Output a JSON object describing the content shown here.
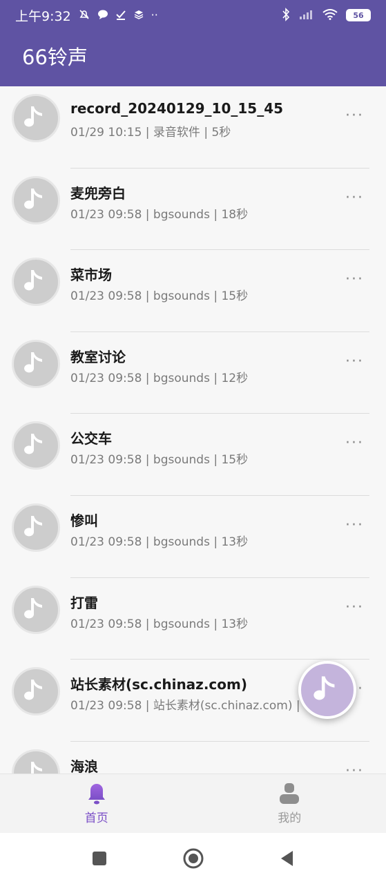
{
  "status_bar": {
    "time": "上午9:32",
    "battery": "56"
  },
  "app": {
    "title": "66铃声"
  },
  "list": {
    "items": [
      {
        "title": "record_20240129_10_15_45",
        "subtitle": "01/29 10:15 | 录音软件 | 5秒"
      },
      {
        "title": "麦兜旁白",
        "subtitle": "01/23 09:58 | bgsounds | 18秒"
      },
      {
        "title": "菜市场",
        "subtitle": "01/23 09:58 | bgsounds | 15秒"
      },
      {
        "title": "教室讨论",
        "subtitle": "01/23 09:58 | bgsounds | 12秒"
      },
      {
        "title": "公交车",
        "subtitle": "01/23 09:58 | bgsounds | 15秒"
      },
      {
        "title": "惨叫",
        "subtitle": "01/23 09:58 | bgsounds | 13秒"
      },
      {
        "title": "打雷",
        "subtitle": "01/23 09:58 | bgsounds | 13秒"
      },
      {
        "title": "站长素材(sc.chinaz.com)",
        "subtitle": "01/23 09:58 | 站长素材(sc.chinaz.com) |"
      },
      {
        "title": "海浪",
        "subtitle": ""
      }
    ],
    "more_label": "···"
  },
  "bottom_nav": {
    "tabs": [
      {
        "label": "首页",
        "icon": "bell-icon",
        "active": true
      },
      {
        "label": "我的",
        "icon": "person-icon",
        "active": false
      }
    ]
  },
  "colors": {
    "header": "#5f53a3",
    "accent": "#7b4fc7",
    "fab": "#c4b4dc"
  }
}
